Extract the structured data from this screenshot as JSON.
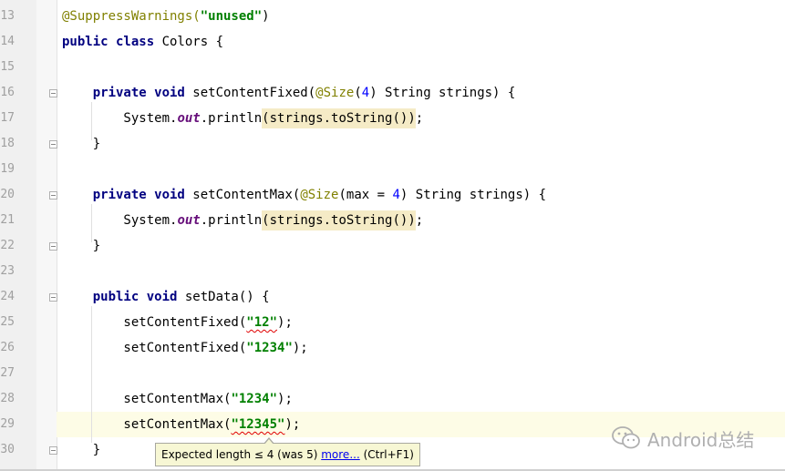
{
  "editor": {
    "lines": [
      {
        "n": "13",
        "tokens": [
          {
            "t": "@SuppressWarnings(",
            "c": "ann"
          },
          {
            "t": "\"unused\"",
            "c": "str"
          },
          {
            "t": ")",
            "c": ""
          }
        ]
      },
      {
        "n": "14",
        "tokens": [
          {
            "t": "public class ",
            "c": "kw"
          },
          {
            "t": "Colors {",
            "c": ""
          }
        ]
      },
      {
        "n": "15",
        "tokens": []
      },
      {
        "n": "16",
        "tokens": [
          {
            "t": "    private void ",
            "c": "kw"
          },
          {
            "t": "setContentFixed(",
            "c": ""
          },
          {
            "t": "@Size",
            "c": "ann"
          },
          {
            "t": "(",
            "c": ""
          },
          {
            "t": "4",
            "c": "num"
          },
          {
            "t": ") String strings) {",
            "c": ""
          }
        ]
      },
      {
        "n": "17",
        "tokens": [
          {
            "t": "        System.",
            "c": ""
          },
          {
            "t": "out",
            "c": "field"
          },
          {
            "t": ".println",
            "c": ""
          },
          {
            "t": "(strings.toString())",
            "c": "hl"
          },
          {
            "t": ";",
            "c": ""
          }
        ]
      },
      {
        "n": "18",
        "tokens": [
          {
            "t": "    }",
            "c": ""
          }
        ]
      },
      {
        "n": "19",
        "tokens": []
      },
      {
        "n": "20",
        "tokens": [
          {
            "t": "    private void ",
            "c": "kw"
          },
          {
            "t": "setContentMax(",
            "c": ""
          },
          {
            "t": "@Size",
            "c": "ann"
          },
          {
            "t": "(max = ",
            "c": ""
          },
          {
            "t": "4",
            "c": "num"
          },
          {
            "t": ") String strings) {",
            "c": ""
          }
        ]
      },
      {
        "n": "21",
        "tokens": [
          {
            "t": "        System.",
            "c": ""
          },
          {
            "t": "out",
            "c": "field"
          },
          {
            "t": ".println",
            "c": ""
          },
          {
            "t": "(strings.toString())",
            "c": "hl"
          },
          {
            "t": ";",
            "c": ""
          }
        ]
      },
      {
        "n": "22",
        "tokens": [
          {
            "t": "    }",
            "c": ""
          }
        ]
      },
      {
        "n": "23",
        "tokens": []
      },
      {
        "n": "24",
        "tokens": [
          {
            "t": "    public void ",
            "c": "kw"
          },
          {
            "t": "setData() {",
            "c": ""
          }
        ]
      },
      {
        "n": "25",
        "tokens": [
          {
            "t": "        setContentFixed(",
            "c": ""
          },
          {
            "t": "\"12\"",
            "c": "str squig"
          },
          {
            "t": ");",
            "c": ""
          }
        ]
      },
      {
        "n": "26",
        "tokens": [
          {
            "t": "        setContentFixed(",
            "c": ""
          },
          {
            "t": "\"1234\"",
            "c": "str"
          },
          {
            "t": ");",
            "c": ""
          }
        ]
      },
      {
        "n": "27",
        "tokens": []
      },
      {
        "n": "28",
        "tokens": [
          {
            "t": "        setContentMax(",
            "c": ""
          },
          {
            "t": "\"1234\"",
            "c": "str"
          },
          {
            "t": ");",
            "c": ""
          }
        ]
      },
      {
        "n": "29",
        "tokens": [
          {
            "t": "        setContentMax(",
            "c": ""
          },
          {
            "t": "\"12345\"",
            "c": "str squig"
          },
          {
            "t": ");",
            "c": ""
          }
        ]
      },
      {
        "n": "30",
        "tokens": [
          {
            "t": "    }",
            "c": ""
          }
        ]
      }
    ],
    "fold_markers_at_lines": [
      "16",
      "18",
      "20",
      "22",
      "24",
      "30"
    ]
  },
  "tooltip": {
    "message": "Expected length ≤ 4 (was 5) ",
    "link": "more...",
    "shortcut": " (Ctrl+F1)"
  },
  "watermark": {
    "text": "Android总结",
    "icon": "wechat-icon"
  },
  "colors": {
    "keyword": "#000080",
    "string": "#008000",
    "annotation": "#808000",
    "number": "#0000ff",
    "field": "#660e7a",
    "current_line": "#fdfce6",
    "tooltip_bg": "#f7f7d4"
  }
}
